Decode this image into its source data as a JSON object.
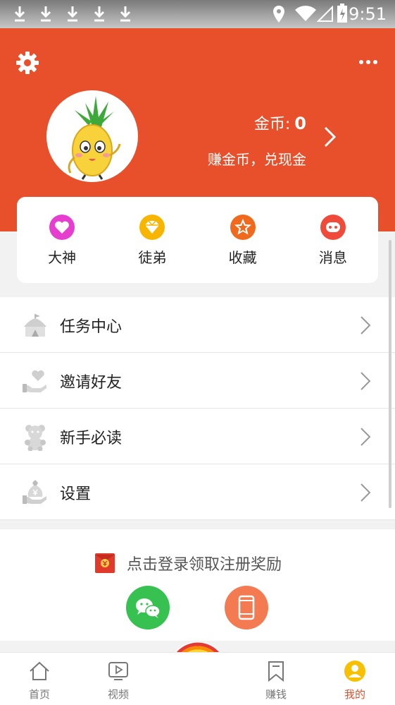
{
  "status_bar": {
    "time": "9:51",
    "download_icons": [
      "download-icon",
      "download-icon",
      "download-icon",
      "download-icon",
      "download-icon"
    ]
  },
  "header": {
    "coins_label": "金币:",
    "coins_value": "0",
    "earn_link": "赚金币，兑现金",
    "background_color": "#e8502c"
  },
  "quick_actions": [
    {
      "label": "大神",
      "icon": "heart-icon",
      "color": "#e63fd0"
    },
    {
      "label": "徒弟",
      "icon": "diamond-icon",
      "color": "#f7b500"
    },
    {
      "label": "收藏",
      "icon": "star-icon",
      "color": "#f06a1e"
    },
    {
      "label": "消息",
      "icon": "chat-icon",
      "color": "#f04a3a"
    }
  ],
  "menu": [
    {
      "label": "任务中心",
      "icon": "tent-icon"
    },
    {
      "label": "邀请好友",
      "icon": "heart-hand-icon"
    },
    {
      "label": "新手必读",
      "icon": "teddy-bear-icon"
    },
    {
      "label": "设置",
      "icon": "money-bag-icon"
    }
  ],
  "login": {
    "prompt": "点击登录领取注册奖励"
  },
  "tabs": [
    {
      "label": "首页",
      "icon": "home-icon",
      "active": false
    },
    {
      "label": "视频",
      "icon": "video-icon",
      "active": false
    },
    {
      "label": "赚钱",
      "icon": "bookmark-icon",
      "active": false
    },
    {
      "label": "我的",
      "icon": "user-icon",
      "active": true
    }
  ]
}
